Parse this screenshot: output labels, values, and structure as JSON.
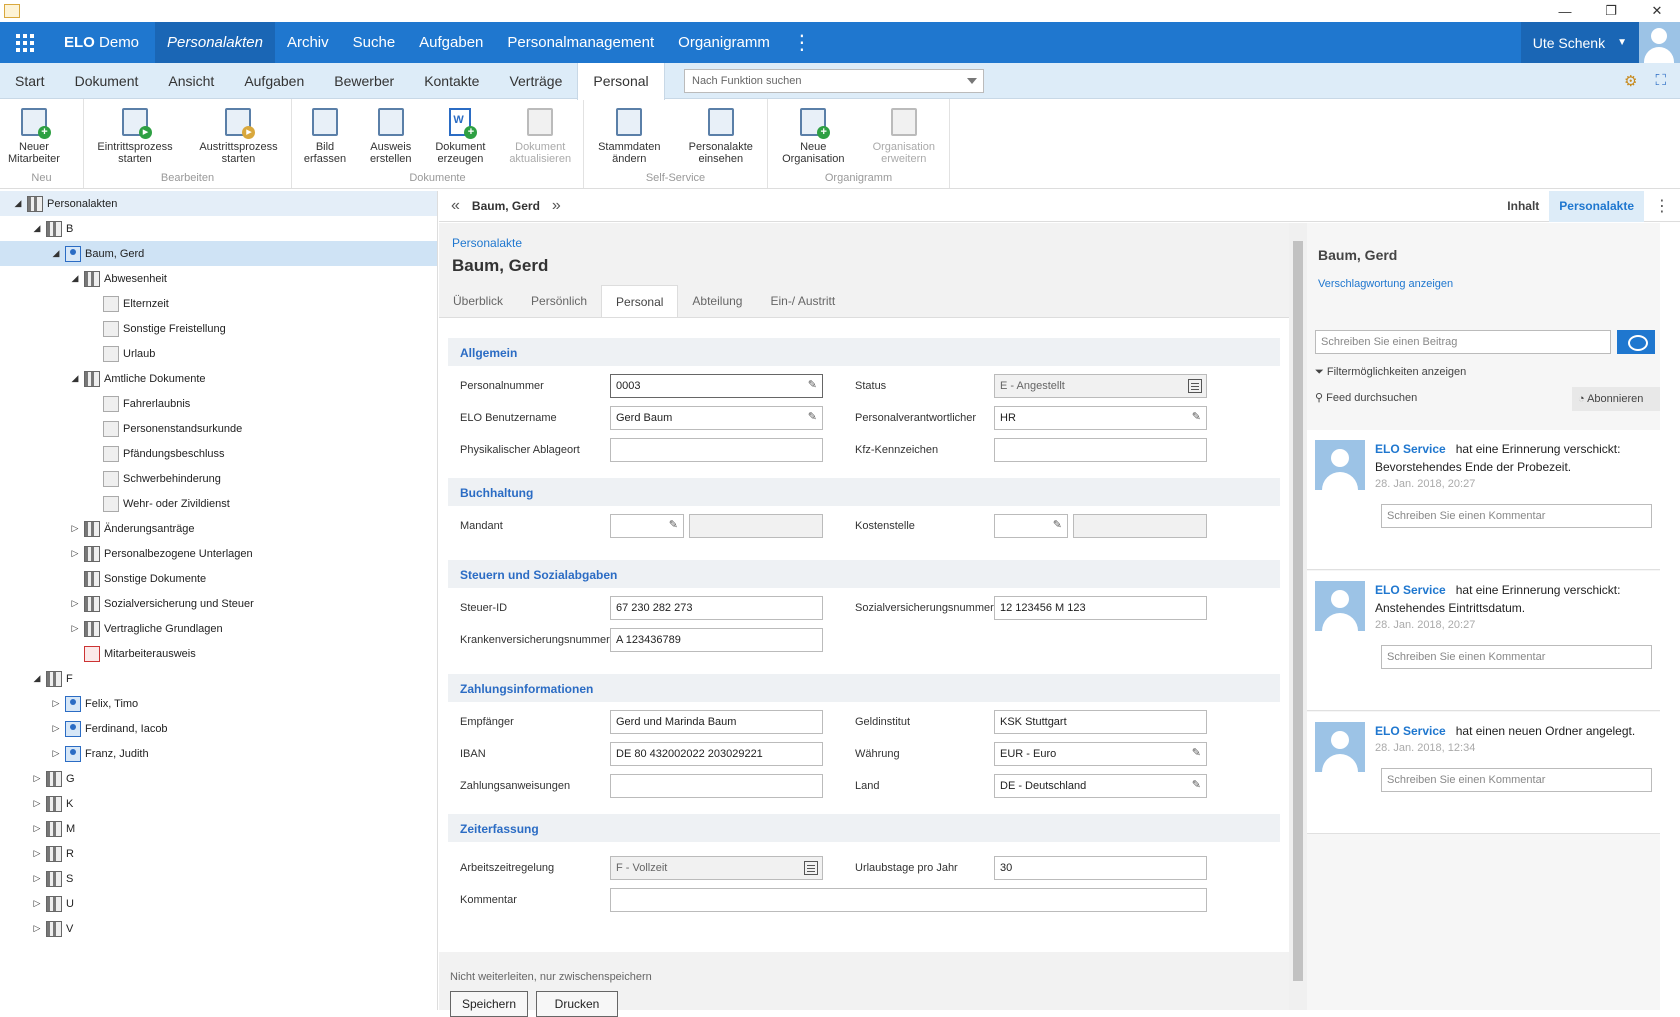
{
  "window": {
    "minimize": "—",
    "restore": "❐",
    "close": "✕"
  },
  "topnav": {
    "brand_bold": "ELO",
    "brand_rest": "Demo",
    "items": [
      "Personalakten",
      "Archiv",
      "Suche",
      "Aufgaben",
      "Personalmanagement",
      "Organigramm"
    ],
    "more": "⋮",
    "user": "Ute Schenk"
  },
  "ribbon_tabs": [
    "Start",
    "Dokument",
    "Ansicht",
    "Aufgaben",
    "Bewerber",
    "Kontakte",
    "Verträge",
    "Personal"
  ],
  "function_search": {
    "placeholder": "Nach Funktion suchen"
  },
  "ribbon_groups": [
    {
      "name": "Neu",
      "buttons": [
        {
          "label": "Neuer\nMitarbeiter"
        }
      ]
    },
    {
      "name": "Bearbeiten",
      "buttons": [
        {
          "label": "Eintrittsprozess\nstarten"
        },
        {
          "label": "Austrittsprozess\nstarten"
        }
      ]
    },
    {
      "name": "Dokumente",
      "buttons": [
        {
          "label": "Bild\nerfassen"
        },
        {
          "label": "Ausweis\nerstellen"
        },
        {
          "label": "Dokument\nerzeugen"
        },
        {
          "label": "Dokument\naktualisieren"
        }
      ]
    },
    {
      "name": "Self-Service",
      "buttons": [
        {
          "label": "Stammdaten\nändern"
        },
        {
          "label": "Personalakte\neinsehen"
        }
      ]
    },
    {
      "name": "Organigramm",
      "buttons": [
        {
          "label": "Neue\nOrganisation"
        },
        {
          "label": "Organisation\nerweitern"
        }
      ]
    }
  ],
  "tree": [
    {
      "label": "Personalakten",
      "toggle": "◢",
      "icon": "folder"
    },
    {
      "label": "B",
      "toggle": "◢",
      "icon": "folder"
    },
    {
      "label": "Baum, Gerd",
      "toggle": "◢",
      "icon": "person"
    },
    {
      "label": "Abwesenheit",
      "toggle": "◢",
      "icon": "folder"
    },
    {
      "label": "Elternzeit",
      "toggle": "",
      "icon": "doc"
    },
    {
      "label": "Sonstige Freistellung",
      "toggle": "",
      "icon": "doc"
    },
    {
      "label": "Urlaub",
      "toggle": "",
      "icon": "doc"
    },
    {
      "label": "Amtliche Dokumente",
      "toggle": "◢",
      "icon": "folder"
    },
    {
      "label": "Fahrerlaubnis",
      "toggle": "",
      "icon": "doc"
    },
    {
      "label": "Personenstandsurkunde",
      "toggle": "",
      "icon": "doc"
    },
    {
      "label": "Pfändungsbeschluss",
      "toggle": "",
      "icon": "doc"
    },
    {
      "label": "Schwerbehinderung",
      "toggle": "",
      "icon": "doc"
    },
    {
      "label": "Wehr- oder Zivildienst",
      "toggle": "",
      "icon": "doc"
    },
    {
      "label": "Änderungsanträge",
      "toggle": "▷",
      "icon": "folder"
    },
    {
      "label": "Personalbezogene Unterlagen",
      "toggle": "▷",
      "icon": "folder"
    },
    {
      "label": "Sonstige Dokumente",
      "toggle": "",
      "icon": "folder"
    },
    {
      "label": "Sozialversicherung und Steuer",
      "toggle": "▷",
      "icon": "folder"
    },
    {
      "label": "Vertragliche Grundlagen",
      "toggle": "▷",
      "icon": "folder"
    },
    {
      "label": "Mitarbeiterausweis",
      "toggle": "",
      "icon": "pdf"
    },
    {
      "label": "F",
      "toggle": "◢",
      "icon": "folder"
    },
    {
      "label": "Felix, Timo",
      "toggle": "▷",
      "icon": "person"
    },
    {
      "label": "Ferdinand, Iacob",
      "toggle": "▷",
      "icon": "person"
    },
    {
      "label": "Franz, Judith",
      "toggle": "▷",
      "icon": "person"
    },
    {
      "label": "G",
      "toggle": "▷",
      "icon": "folder"
    },
    {
      "label": "K",
      "toggle": "▷",
      "icon": "folder"
    },
    {
      "label": "M",
      "toggle": "▷",
      "icon": "folder"
    },
    {
      "label": "R",
      "toggle": "▷",
      "icon": "folder"
    },
    {
      "label": "S",
      "toggle": "▷",
      "icon": "folder"
    },
    {
      "label": "U",
      "toggle": "▷",
      "icon": "folder"
    },
    {
      "label": "V",
      "toggle": "▷",
      "icon": "folder"
    }
  ],
  "center": {
    "nav_prev": "«",
    "nav_next": "»",
    "name": "Baum, Gerd",
    "breadcrumb": "Personalakte",
    "title": "Baum, Gerd",
    "tabs": [
      "Überblick",
      "Persönlich",
      "Personal",
      "Abteilung",
      "Ein-/ Austritt"
    ],
    "sections": {
      "allgemein": "Allgemein",
      "buchhaltung": "Buchhaltung",
      "steuern": "Steuern und Sozialabgaben",
      "zahlung": "Zahlungsinformationen",
      "zeit": "Zeiterfassung"
    },
    "fields": {
      "personalnummer": {
        "label": "Personalnummer",
        "value": "0003"
      },
      "status": {
        "label": "Status",
        "value": "E - Angestellt"
      },
      "benutzername": {
        "label": "ELO Benutzername",
        "value": "Gerd Baum"
      },
      "verantwortlicher": {
        "label": "Personalverantwortlicher",
        "value": "HR"
      },
      "ablageort": {
        "label": "Physikalischer Ablageort",
        "value": ""
      },
      "kfz": {
        "label": "Kfz-Kennzeichen",
        "value": ""
      },
      "mandant": {
        "label": "Mandant",
        "value": ""
      },
      "kostenstelle": {
        "label": "Kostenstelle",
        "value": ""
      },
      "steuerid": {
        "label": "Steuer-ID",
        "value": "67 230 282 273"
      },
      "svnr": {
        "label": "Sozialversicherungsnummer",
        "value": "12 123456 M 123"
      },
      "kvnr": {
        "label": "Krankenversicherungsnummer",
        "value": "A 123436789"
      },
      "empfaenger": {
        "label": "Empfänger",
        "value": "Gerd und Marinda Baum"
      },
      "geldinstitut": {
        "label": "Geldinstitut",
        "value": "KSK Stuttgart"
      },
      "iban": {
        "label": "IBAN",
        "value": "DE 80 432002022 203029221"
      },
      "waehrung": {
        "label": "Währung",
        "value": "EUR - Euro"
      },
      "anweisungen": {
        "label": "Zahlungsanweisungen",
        "value": ""
      },
      "land": {
        "label": "Land",
        "value": "DE - Deutschland"
      },
      "arbeitszeit": {
        "label": "Arbeitszeitregelung",
        "value": "F - Vollzeit"
      },
      "urlaubstage": {
        "label": "Urlaubstage pro Jahr",
        "value": "30"
      },
      "kommentar": {
        "label": "Kommentar",
        "value": ""
      }
    },
    "footer_hint": "Nicht weiterleiten, nur zwischenspeichern",
    "save": "Speichern",
    "print": "Drucken"
  },
  "right": {
    "tabs": [
      "Inhalt",
      "Personalakte"
    ],
    "more": "⋮",
    "name": "Baum, Gerd",
    "keyword_link": "Verschlagwortung anzeigen",
    "post_placeholder": "Schreiben Sie einen Beitrag",
    "filter": "Filtermöglichkeiten anzeigen",
    "feed_search": "Feed durchsuchen",
    "subscribe": "Abonnieren",
    "feed": [
      {
        "who": "ELO Service",
        "text": "hat eine Erinnerung verschickt: Bevorstehendes Ende der Probezeit.",
        "date": "28. Jan. 2018, 20:27",
        "comment": "Schreiben Sie einen Kommentar"
      },
      {
        "who": "ELO Service",
        "text": "hat eine Erinnerung verschickt: Anstehendes Eintrittsdatum.",
        "date": "28. Jan. 2018, 20:27",
        "comment": "Schreiben Sie einen Kommentar"
      },
      {
        "who": "ELO Service",
        "text": "hat einen neuen Ordner angelegt.",
        "date": "28. Jan. 2018, 12:34",
        "comment": "Schreiben Sie einen Kommentar"
      }
    ]
  }
}
